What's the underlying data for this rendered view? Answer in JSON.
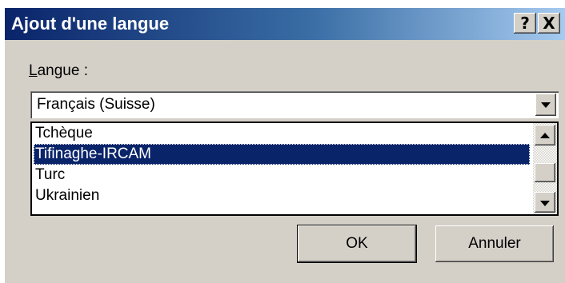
{
  "dialog": {
    "title": "Ajout d'une langue",
    "help_label": "?",
    "close_label": "X"
  },
  "language": {
    "label_accel": "L",
    "label_rest": "angue :",
    "selected_value": "Français (Suisse)",
    "options": [
      {
        "label": "Tchèque",
        "selected": false
      },
      {
        "label": "Tifinaghe-IRCAM",
        "selected": true
      },
      {
        "label": "Turc",
        "selected": false
      },
      {
        "label": "Ukrainien",
        "selected": false
      }
    ]
  },
  "buttons": {
    "ok_label": "OK",
    "cancel_label": "Annuler"
  },
  "colors": {
    "selection": "#0a246a",
    "face": "#d4d0c8"
  }
}
